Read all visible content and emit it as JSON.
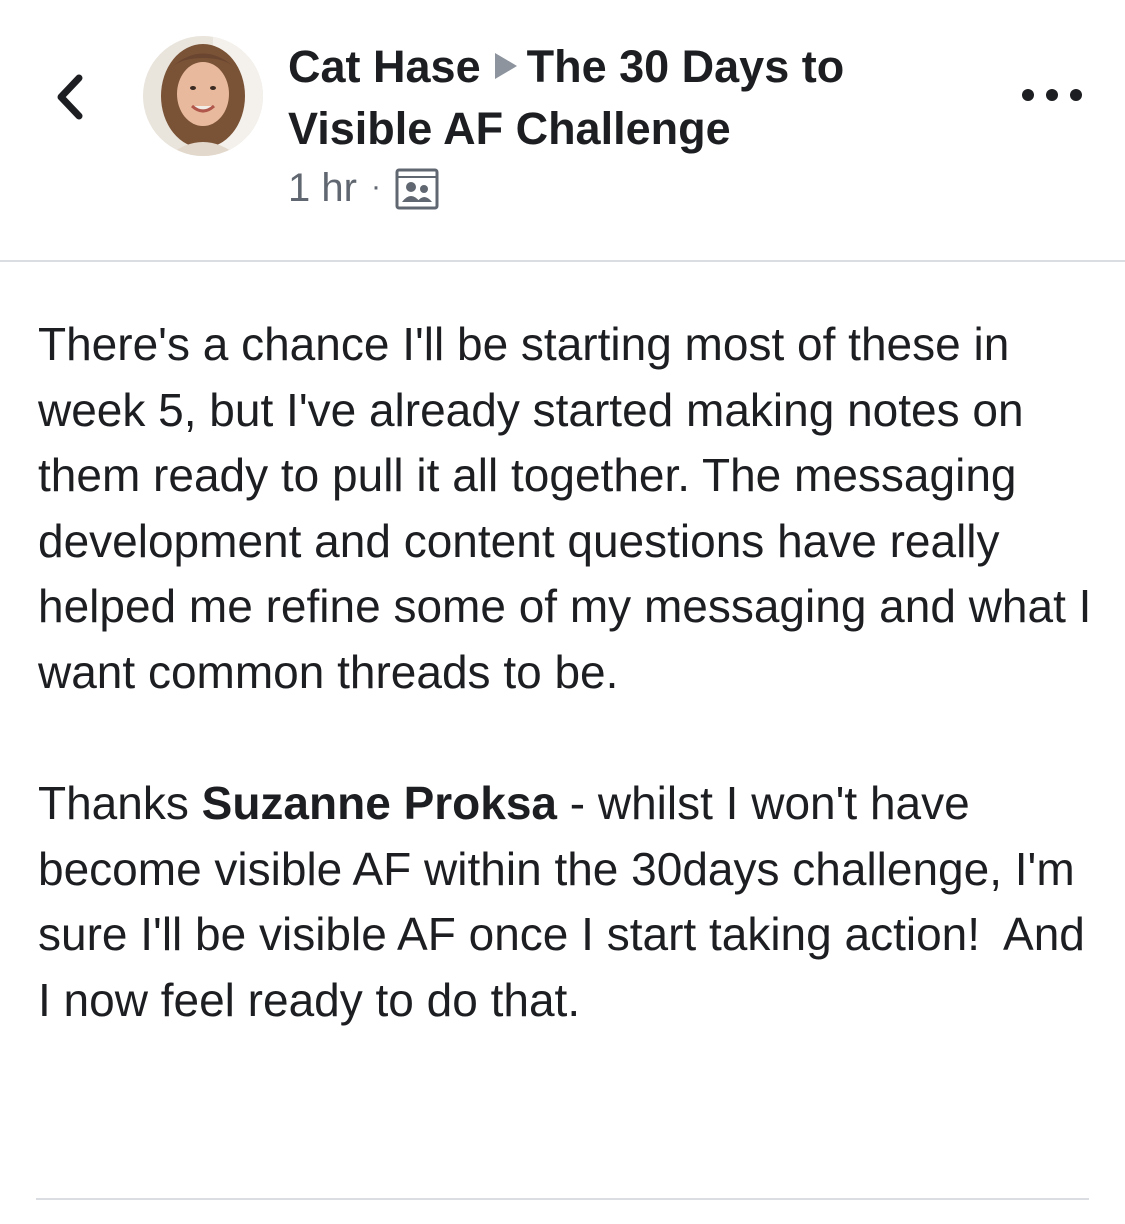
{
  "post": {
    "author": "Cat Hase",
    "group": "The 30 Days to Visible AF Challenge",
    "time": "1 hr",
    "separator": "·",
    "privacy_icon": "group-members-icon",
    "paragraph_1": "There's a chance I'll be starting most of these in week 5, but I've already started making notes on them ready to pull it all together. The messaging development and content questions have really helped me refine some of my messaging and what I want common threads to be.",
    "paragraph_2_prefix": "Thanks ",
    "mention": "Suzanne Proksa",
    "paragraph_2_rest": " - whilst I won't have become visible AF within the 30days challenge, I'm sure I'll be visible AF once I start taking action!  And I now feel ready to do that."
  },
  "header": {
    "back_icon": "chevron-left-icon",
    "more_icon": "more-horizontal-icon"
  },
  "colors": {
    "text": "#1c1e21",
    "secondary": "#606770",
    "divider": "#dadde1",
    "arrow": "#8d949e"
  }
}
